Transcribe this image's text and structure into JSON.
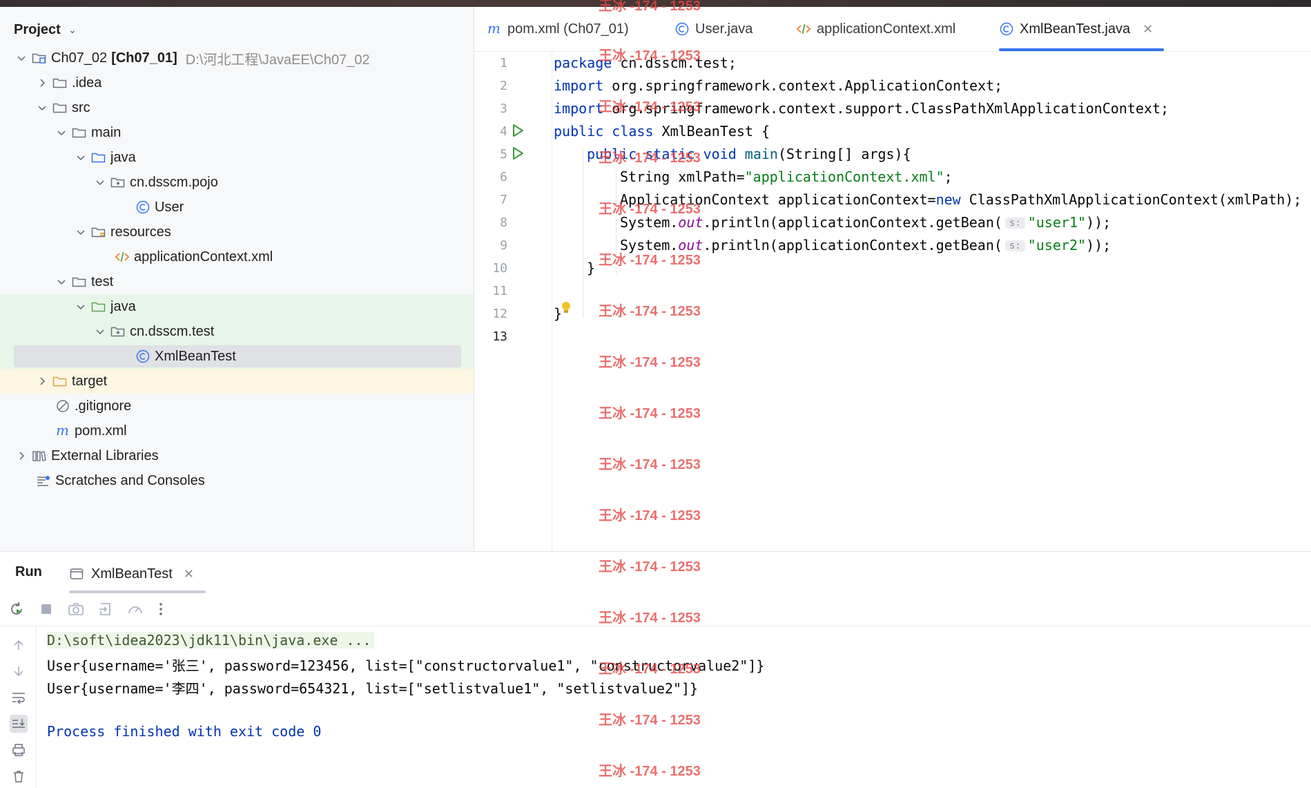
{
  "project_panel": {
    "title": "Project",
    "tree": [
      {
        "name": "Ch07_02",
        "module": "[Ch07_01]",
        "path": "D:\\河北工程\\JavaEE\\Ch07_02"
      },
      {
        "name": ".idea"
      },
      {
        "name": "src"
      },
      {
        "name": "main"
      },
      {
        "name": "java"
      },
      {
        "name": "cn.dsscm.pojo"
      },
      {
        "name": "User"
      },
      {
        "name": "resources"
      },
      {
        "name": "applicationContext.xml"
      },
      {
        "name": "test"
      },
      {
        "name": "java"
      },
      {
        "name": "cn.dsscm.test"
      },
      {
        "name": "XmlBeanTest"
      },
      {
        "name": "target"
      },
      {
        "name": ".gitignore"
      },
      {
        "name": "pom.xml"
      },
      {
        "name": "External Libraries"
      },
      {
        "name": "Scratches and Consoles"
      }
    ]
  },
  "editor_tabs": [
    {
      "label": "pom.xml (Ch07_01)"
    },
    {
      "label": "User.java"
    },
    {
      "label": "applicationContext.xml"
    },
    {
      "label": "XmlBeanTest.java"
    }
  ],
  "editor": {
    "line_numbers": [
      "1",
      "2",
      "3",
      "4",
      "5",
      "6",
      "7",
      "8",
      "9",
      "10",
      "11",
      "12",
      "13"
    ],
    "code": {
      "l1_kw": "package",
      "l1_rest": " cn.dsscm.test;",
      "l2_kw": "import",
      "l2_rest": " org.springframework.context.ApplicationContext;",
      "l3_kw": "import",
      "l3_rest": " org.springframework.context.support.ClassPathXmlApplicationContext;",
      "l4_kw": "public class",
      "l4_rest": " XmlBeanTest {",
      "l5_kw": "public static void",
      "l5_method": " main",
      "l5_rest": "(String[] args){",
      "l6_pre": "String xmlPath=",
      "l6_str": "\"applicationContext.xml\"",
      "l6_post": ";",
      "l7_pre": "ApplicationContext applicationContext=",
      "l7_kw": "new",
      "l7_post": " ClassPathXmlApplicationContext(xmlPath);",
      "l8_pre": "System.",
      "l8_fld": "out",
      "l8_mid": ".println(applicationContext.getBean(",
      "l8_hint": "s:",
      "l8_str": "\"user1\"",
      "l8_post": "));",
      "l9_pre": "System.",
      "l9_fld": "out",
      "l9_mid": ".println(applicationContext.getBean(",
      "l9_hint": "s:",
      "l9_str": "\"user2\"",
      "l9_post": "));",
      "l10": "}",
      "l12": "}"
    }
  },
  "run_panel": {
    "title": "Run",
    "tab_label": "XmlBeanTest",
    "console": [
      "D:\\soft\\idea2023\\jdk11\\bin\\java.exe ...",
      "User{username='张三', password=123456, list=[\"constructorvalue1\", \"constructorvalue2\"]}",
      "User{username='李四', password=654321, list=[\"setlistvalue1\", \"setlistvalue2\"]}",
      "",
      "Process finished with exit code 0"
    ]
  },
  "watermark": "王冰 -174 - 1253",
  "colors": {
    "keyword": "#0033b3",
    "string": "#067d17",
    "static_field": "#871094",
    "accent": "#3574f0",
    "watermark": "#e64646"
  }
}
